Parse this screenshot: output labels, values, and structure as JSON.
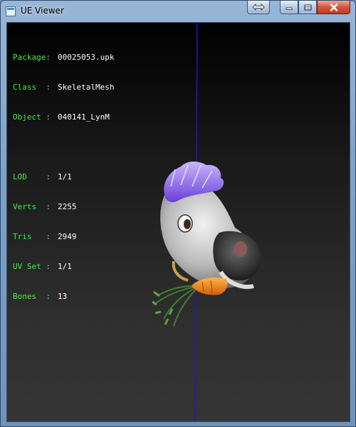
{
  "window": {
    "title": "UE Viewer"
  },
  "info": {
    "package": {
      "label": "Package:",
      "value": "00025053.upk"
    },
    "class": {
      "label": "Class  :",
      "value": "SkeletalMesh"
    },
    "object": {
      "label": "Object :",
      "value": "040141_LynM"
    },
    "lod": {
      "label": "LOD    :",
      "value": "1/1"
    },
    "verts": {
      "label": "Verts  :",
      "value": "2255"
    },
    "tris": {
      "label": "Tris   :",
      "value": "2949"
    },
    "uvset": {
      "label": "UV Set :",
      "value": "1/1"
    },
    "bones": {
      "label": "Bones  :",
      "value": "13"
    }
  },
  "colors": {
    "label": "#3ff03f",
    "value": "#ffffff",
    "axis": "#1a1acc"
  },
  "icons": {
    "app": "app-icon",
    "extra": "double-arrow-icon",
    "minimize": "minimize-icon",
    "maximize": "maximize-icon",
    "close": "close-icon"
  }
}
